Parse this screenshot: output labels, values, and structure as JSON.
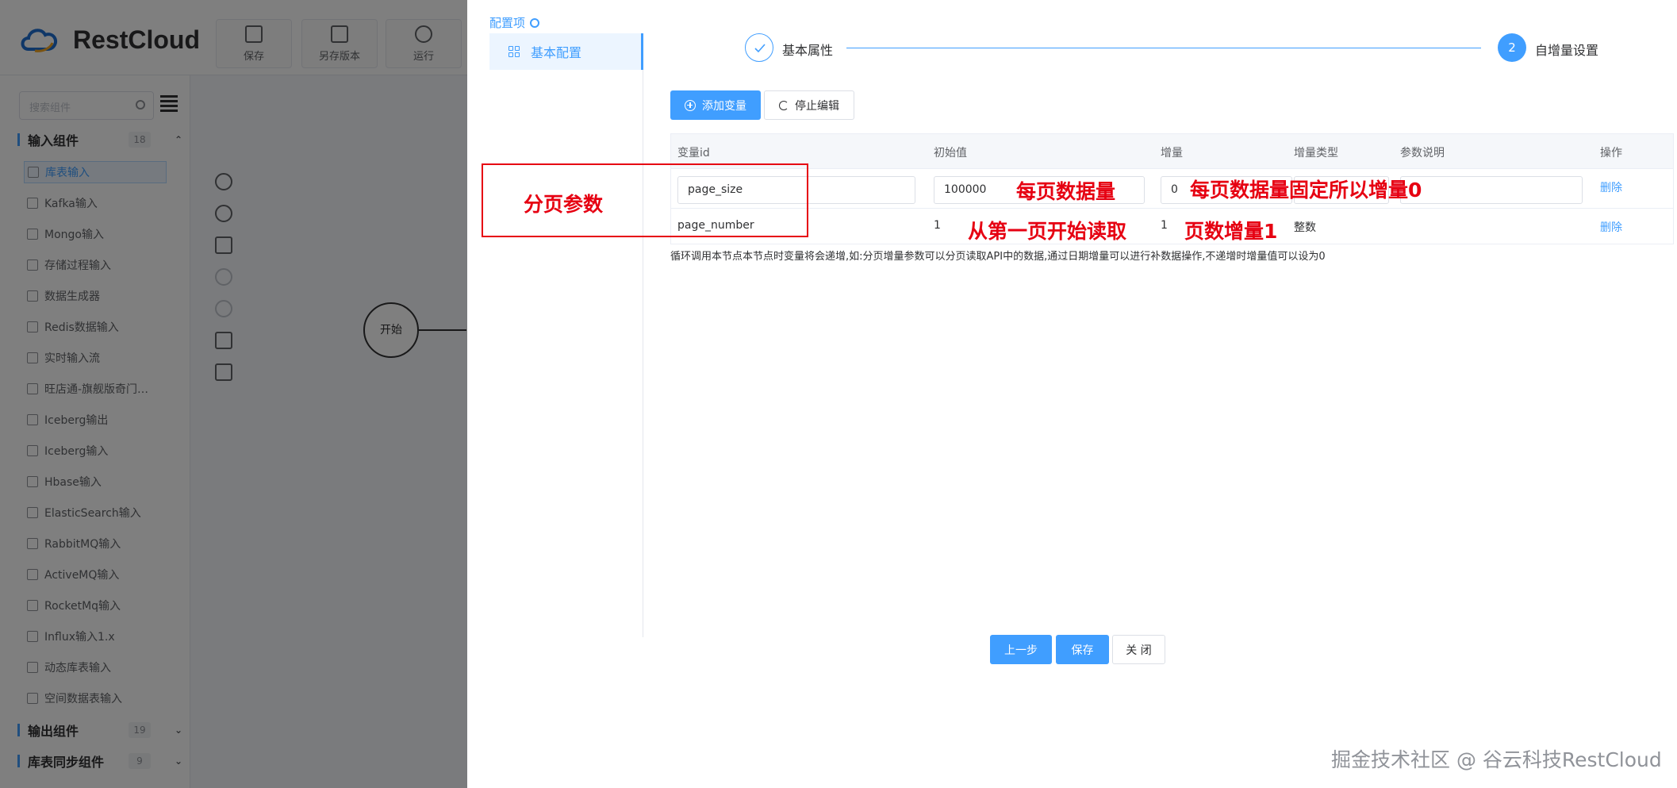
{
  "app": {
    "logo_text": "RestCloud",
    "toolbar": [
      {
        "label": "保存",
        "icon": "save-icon"
      },
      {
        "label": "另存版本",
        "icon": "copy-icon"
      },
      {
        "label": "运行",
        "icon": "run-icon"
      }
    ]
  },
  "sidebar": {
    "search_placeholder": "搜索组件",
    "input_group": {
      "label": "输入组件",
      "count": "18",
      "chevron": "⌃"
    },
    "items": [
      {
        "label": "库表输入"
      },
      {
        "label": "Kafka输入"
      },
      {
        "label": "Mongo输入"
      },
      {
        "label": "存储过程输入"
      },
      {
        "label": "数据生成器"
      },
      {
        "label": "Redis数据输入"
      },
      {
        "label": "实时输入流"
      },
      {
        "label": "旺店通-旗舰版奇门…"
      },
      {
        "label": "Iceberg输出"
      },
      {
        "label": "Iceberg输入"
      },
      {
        "label": "Hbase输入"
      },
      {
        "label": "ElasticSearch输入"
      },
      {
        "label": "RabbitMQ输入"
      },
      {
        "label": "ActiveMQ输入"
      },
      {
        "label": "RocketMq输入"
      },
      {
        "label": "Influx输入1.x"
      },
      {
        "label": "动态库表输入"
      },
      {
        "label": "空间数据表输入"
      }
    ],
    "output_group": {
      "label": "输出组件",
      "count": "19",
      "chevron": "⌄"
    },
    "sync_group": {
      "label": "库表同步组件",
      "count": "9",
      "chevron": "⌄"
    }
  },
  "canvas": {
    "start_node_label": "开始"
  },
  "drawer": {
    "config_title": "配置项",
    "nav_item": "基本配置",
    "steps": {
      "step1_label": "基本属性",
      "step2_number": "2",
      "step2_label": "自增量设置"
    },
    "buttons": {
      "add_variable": "添加变量",
      "stop_edit": "停止编辑"
    },
    "table": {
      "headers": [
        "变量id",
        "初始值",
        "增量",
        "增量类型",
        "参数说明",
        "操作"
      ],
      "rows": [
        {
          "var_id": "page_size",
          "init": "100000",
          "incr": "0",
          "type": "",
          "desc": "",
          "action": "删除"
        },
        {
          "var_id": "page_number",
          "init": "1",
          "incr": "1",
          "type": "整数",
          "desc": "",
          "action": "删除"
        }
      ]
    },
    "tip": "循环调用本节点本节点时变量将会递增,如:分页增量参数可以分页读取API中的数据,通过日期增量可以进行补数据操作,不递增时增量值可以设为0",
    "footer": {
      "prev": "上一步",
      "save": "保存",
      "close": "关 闭"
    }
  },
  "annotations": {
    "paging_params": "分页参数",
    "per_page_amount": "每页数据量",
    "per_page_fixed": "每页数据量固定所以增量0",
    "read_from_first": "从第一页开始读取",
    "page_increment": "页数增量1"
  },
  "watermark": "掘金技术社区 @ 谷云科技RestCloud",
  "colors": {
    "primary": "#409eff",
    "annotation_red": "#e60012",
    "mask": "rgba(0,0,0,0.5)"
  }
}
